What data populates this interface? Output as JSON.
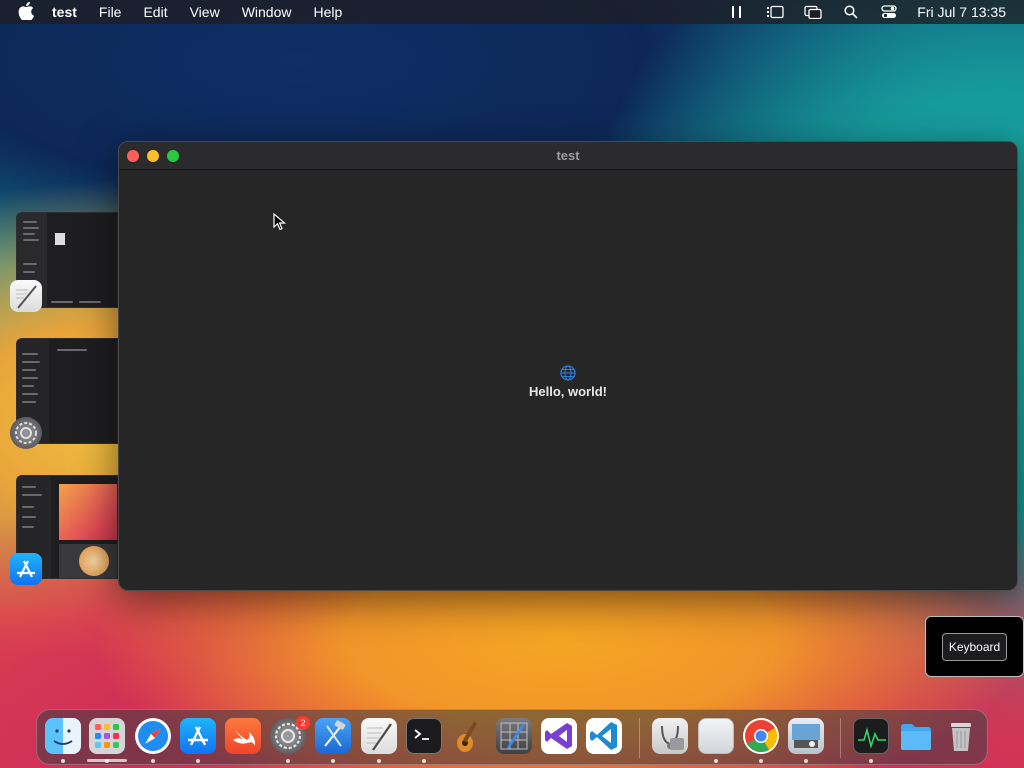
{
  "menubar": {
    "app_name": "test",
    "menus": [
      "File",
      "Edit",
      "View",
      "Window",
      "Help"
    ],
    "clock": "Fri Jul 7  13:35",
    "status_icons": [
      "pause-icon",
      "stage-manager-icon",
      "screen-mirroring-icon",
      "spotlight-search-icon",
      "control-center-icon"
    ]
  },
  "window": {
    "title": "test",
    "hello_text": "Hello, world!",
    "globe_color": "#2f7bd6"
  },
  "keyboard_panel": {
    "button_label": "Keyboard"
  },
  "dock": {
    "apps": [
      "Finder",
      "Launchpad",
      "Safari",
      "App Store",
      "Swift Playgrounds",
      "System Settings",
      "Xcode",
      "TextEdit",
      "Terminal",
      "GarageBand",
      "Instruments",
      "Visual Studio",
      "Visual Studio Code",
      "Disk Utility",
      "Preview",
      "Google Chrome",
      "Image Capture",
      "Activity Monitor",
      "Downloads",
      "Trash"
    ],
    "system_settings_badge": "2"
  },
  "colors": {
    "traffic_close": "#fe5f57",
    "traffic_minimize": "#febc2e",
    "traffic_zoom": "#28c840"
  }
}
